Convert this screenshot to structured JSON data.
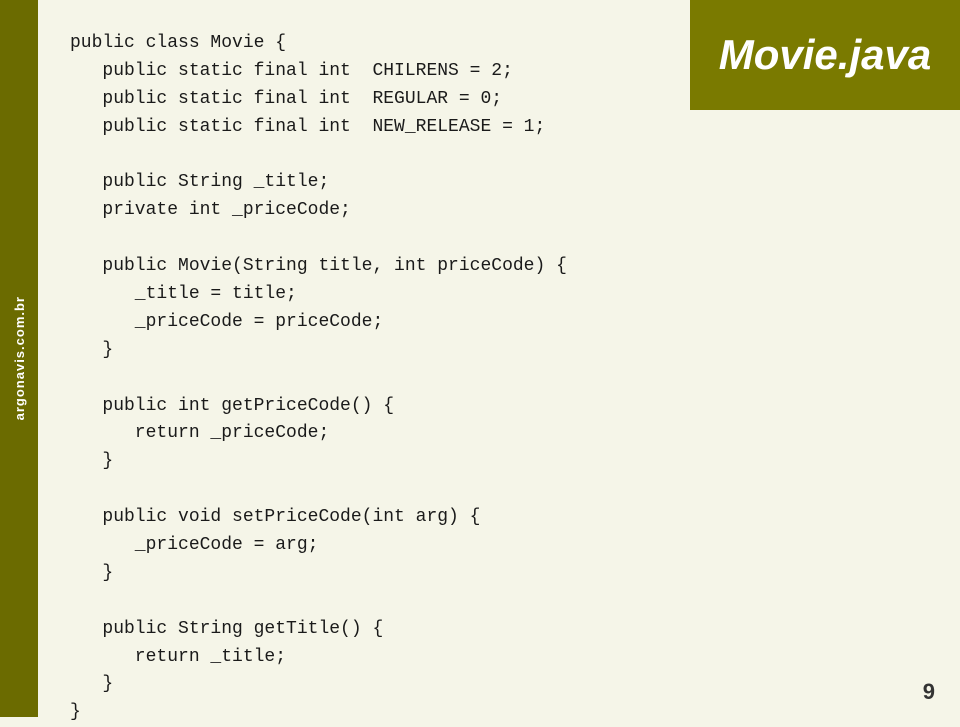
{
  "leftBar": {
    "text": "argonavis.com.br"
  },
  "header": {
    "title": "Movie.java"
  },
  "code": {
    "lines": [
      "public class Movie {",
      "   public static final int  CHILRENS = 2;",
      "   public static final int  REGULAR = 0;",
      "   public static final int  NEW_RELEASE = 1;",
      "",
      "   public String _title;",
      "   private int _priceCode;",
      "",
      "   public Movie(String title, int priceCode) {",
      "      _title = title;",
      "      _priceCode = priceCode;",
      "   }",
      "",
      "   public int getPriceCode() {",
      "      return _priceCode;",
      "   }",
      "",
      "   public void setPriceCode(int arg) {",
      "      _priceCode = arg;",
      "   }",
      "",
      "   public String getTitle() {",
      "      return _title;",
      "   }",
      "}"
    ]
  },
  "pageNumber": "9"
}
